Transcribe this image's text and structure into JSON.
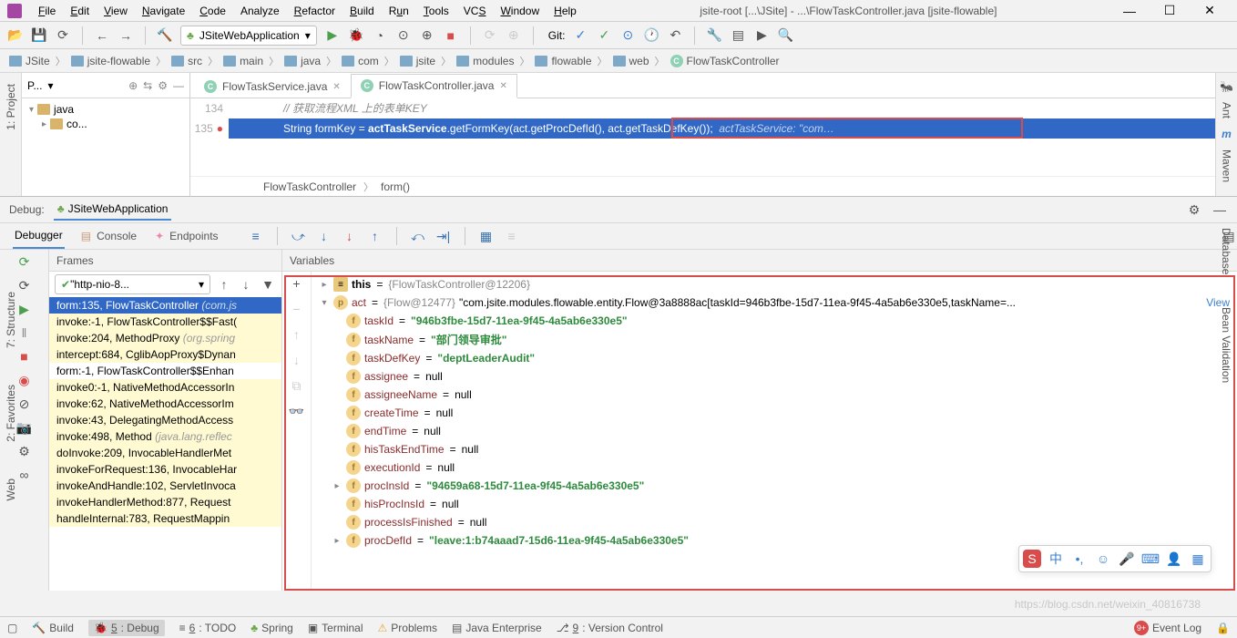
{
  "window": {
    "title": "jsite-root [...\\JSite] - ...\\FlowTaskController.java [jsite-flowable]"
  },
  "menu": {
    "file": "File",
    "edit": "Edit",
    "view": "View",
    "navigate": "Navigate",
    "code": "Code",
    "analyze": "Analyze",
    "refactor": "Refactor",
    "build": "Build",
    "run": "Run",
    "tools": "Tools",
    "vcs": "VCS",
    "window": "Window",
    "help": "Help"
  },
  "run_config": {
    "name": "JSiteWebApplication"
  },
  "toolbar": {
    "git_label": "Git:"
  },
  "breadcrumbs": [
    "JSite",
    "jsite-flowable",
    "src",
    "main",
    "java",
    "com",
    "jsite",
    "modules",
    "flowable",
    "web",
    "FlowTaskController"
  ],
  "left_tabs": {
    "project": "1: Project",
    "structure": "7: Structure",
    "favorites": "2: Favorites",
    "web": "Web"
  },
  "right_tabs": {
    "ant": "Ant",
    "maven": "Maven",
    "database": "Database",
    "validation": "Bean Validation"
  },
  "project_panel": {
    "title": "P...",
    "node1": "java",
    "node2": "co..."
  },
  "editor": {
    "tabs": {
      "task_service": "FlowTaskService.java",
      "controller": "FlowTaskController.java"
    },
    "lines": {
      "l134": "134",
      "l135": "135"
    },
    "comment": "//  获取流程XML 上的表单KEY",
    "code_prefix": "String formKey = ",
    "code_svc": "actTaskService",
    "code_dot": ".getFormKey",
    "code_args": "(act.getProcDefId(), act.getTaskDefKey());",
    "code_hint": "actTaskService: \"com…",
    "inner_bc": {
      "class": "FlowTaskController",
      "method": "form()"
    }
  },
  "debug": {
    "label": "Debug:",
    "run_name": "JSiteWebApplication",
    "tabs": {
      "debugger": "Debugger",
      "console": "Console",
      "endpoints": "Endpoints"
    },
    "panels": {
      "frames": "Frames",
      "variables": "Variables"
    },
    "thread": "\"http-nio-8...",
    "frames": [
      {
        "text": "form:135, FlowTaskController ",
        "dim": "(com.js",
        "sel": true
      },
      {
        "text": "invoke:-1, FlowTaskController$$Fast(",
        "dim": ""
      },
      {
        "text": "invoke:204, MethodProxy ",
        "dim": "(org.spring"
      },
      {
        "text": "intercept:684, CglibAopProxy$Dynan",
        "dim": ""
      },
      {
        "text": "form:-1, FlowTaskController$$Enhan",
        "dim": ""
      },
      {
        "text": "invoke0:-1, NativeMethodAccessorIn",
        "dim": ""
      },
      {
        "text": "invoke:62, NativeMethodAccessorIm",
        "dim": ""
      },
      {
        "text": "invoke:43, DelegatingMethodAccess",
        "dim": ""
      },
      {
        "text": "invoke:498, Method ",
        "dim": "(java.lang.reflec"
      },
      {
        "text": "doInvoke:209, InvocableHandlerMet",
        "dim": ""
      },
      {
        "text": "invokeForRequest:136, InvocableHar",
        "dim": ""
      },
      {
        "text": "invokeAndHandle:102, ServletInvoca",
        "dim": ""
      },
      {
        "text": "invokeHandlerMethod:877, Request",
        "dim": ""
      },
      {
        "text": "handleInternal:783, RequestMappin",
        "dim": ""
      }
    ],
    "vars": {
      "this_label": "this",
      "this_val": "{FlowTaskController@12206}",
      "act_label": "act",
      "act_type": "{Flow@12477}",
      "act_val": " \"com.jsite.modules.flowable.entity.Flow@3a8888ac[taskId=946b3fbe-15d7-11ea-9f45-4a5ab6e330e5,taskName=...",
      "view": "View",
      "fields": [
        {
          "name": "taskId",
          "val": "\"946b3fbe-15d7-11ea-9f45-4a5ab6e330e5\"",
          "isStr": true
        },
        {
          "name": "taskName",
          "val": "\"部门领导审批\"",
          "isStr": true
        },
        {
          "name": "taskDefKey",
          "val": "\"deptLeaderAudit\"",
          "isStr": true
        },
        {
          "name": "assignee",
          "val": "null",
          "isStr": false
        },
        {
          "name": "assigneeName",
          "val": "null",
          "isStr": false
        },
        {
          "name": "createTime",
          "val": "null",
          "isStr": false
        },
        {
          "name": "endTime",
          "val": "null",
          "isStr": false
        },
        {
          "name": "hisTaskEndTime",
          "val": "null",
          "isStr": false
        },
        {
          "name": "executionId",
          "val": "null",
          "isStr": false
        },
        {
          "name": "procInsId",
          "val": "\"94659a68-15d7-11ea-9f45-4a5ab6e330e5\"",
          "isStr": true,
          "expandable": true
        },
        {
          "name": "hisProcInsId",
          "val": "null",
          "isStr": false
        },
        {
          "name": "processIsFinished",
          "val": "null",
          "isStr": false
        },
        {
          "name": "procDefId",
          "val": "\"leave:1:b74aaad7-15d6-11ea-9f45-4a5ab6e330e5\"",
          "isStr": true,
          "expandable": true
        }
      ]
    }
  },
  "statusbar": {
    "build": "Build",
    "debug": "5: Debug",
    "todo": "6: TODO",
    "spring": "Spring",
    "terminal": "Terminal",
    "problems": "Problems",
    "java_ee": "Java Enterprise",
    "vc": "9: Version Control",
    "event_log": "Event Log",
    "badge": "9+"
  },
  "input_bar": {
    "cn": "中"
  },
  "watermark": "https://blog.csdn.net/weixin_40816738"
}
